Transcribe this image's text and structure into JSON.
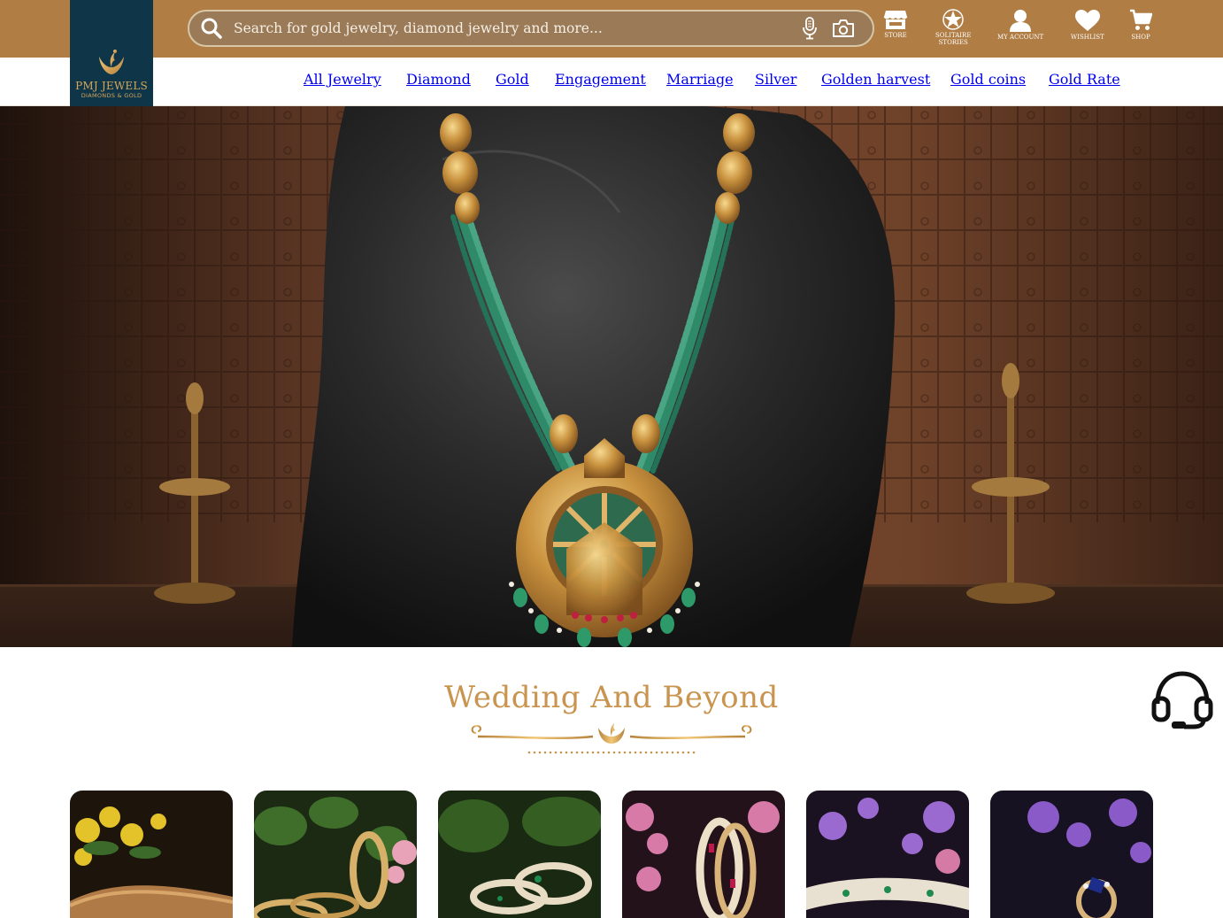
{
  "brand": {
    "name": "PMJ JEWELS",
    "tagline": "DIAMONDS & GOLD",
    "header_color": "#b07d44",
    "logo_bg": "#0f3548",
    "accent_gold": "#c9944f"
  },
  "search": {
    "placeholder": "Search for gold jewelry, diamond jewelry and more...",
    "icons": [
      "search-icon",
      "microphone-icon",
      "camera-icon"
    ]
  },
  "header_actions": [
    {
      "label": "STORE",
      "icon": "store-icon"
    },
    {
      "label": "SOLITAIRE\nSTORIES",
      "icon": "diamond-star-icon"
    },
    {
      "label": "MY ACCOUNT",
      "icon": "user-icon"
    },
    {
      "label": "WISHLIST",
      "icon": "heart-icon"
    },
    {
      "label": "SHOP",
      "icon": "cart-icon"
    }
  ],
  "nav": [
    "All Jewelry",
    "Diamond",
    "Gold",
    "Engagement",
    "Marriage",
    "Silver",
    "Golden harvest",
    "Gold coins",
    "Gold Rate"
  ],
  "hero": {
    "image": "gold-temple-necklace-with-emerald-beads-on-black-stone"
  },
  "section": {
    "title": "Wedding And Beyond",
    "support_icon": "headset-support-icon"
  },
  "cards": [
    {
      "image": "antique-gold-waist-belt-yellow-flowers"
    },
    {
      "image": "gold-bangles-green-leaves-pink-flowers"
    },
    {
      "image": "diamond-emerald-bangles-green-backdrop"
    },
    {
      "image": "ruby-diamond-bangles-pink-flowers"
    },
    {
      "image": "diamond-emerald-waist-belt-purple-flowers"
    },
    {
      "image": "sapphire-diamond-ring-purple-flowers"
    }
  ]
}
